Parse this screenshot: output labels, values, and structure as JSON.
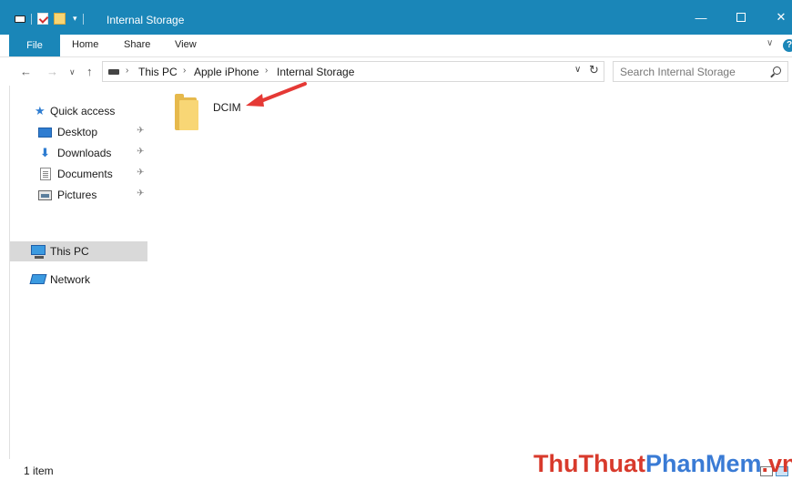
{
  "window": {
    "title": "Internal Storage",
    "controls": {
      "minimize": "—",
      "close": "✕"
    }
  },
  "ribbon": {
    "tabs": [
      {
        "label": "File"
      },
      {
        "label": "Home"
      },
      {
        "label": "Share"
      },
      {
        "label": "View"
      }
    ],
    "help": "?"
  },
  "address_bar": {
    "breadcrumbs": [
      "This PC",
      "Apple iPhone",
      "Internal Storage"
    ],
    "separator": "›"
  },
  "search": {
    "placeholder": "Search Internal Storage"
  },
  "nav_pane": {
    "items": [
      {
        "label": "Quick access",
        "icon": "star-icon"
      },
      {
        "label": "Desktop",
        "icon": "desktop-icon",
        "pinned": true
      },
      {
        "label": "Downloads",
        "icon": "download-icon",
        "pinned": true
      },
      {
        "label": "Documents",
        "icon": "documents-icon",
        "pinned": true
      },
      {
        "label": "Pictures",
        "icon": "pictures-icon",
        "pinned": true
      },
      {
        "label": "This PC",
        "icon": "computer-icon",
        "selected": true
      },
      {
        "label": "Network",
        "icon": "network-icon"
      }
    ]
  },
  "content": {
    "items": [
      {
        "name": "DCIM",
        "type": "folder"
      }
    ]
  },
  "status_bar": {
    "item_count": "1 item"
  },
  "watermark": {
    "part1": "ThuThuat",
    "part2": "PhanMem",
    "part3": ".vn"
  },
  "colors": {
    "titlebar": "#1a86b8",
    "selection": "#d9d9d9",
    "arrow": "#e53935",
    "folder": "#f8d675"
  }
}
